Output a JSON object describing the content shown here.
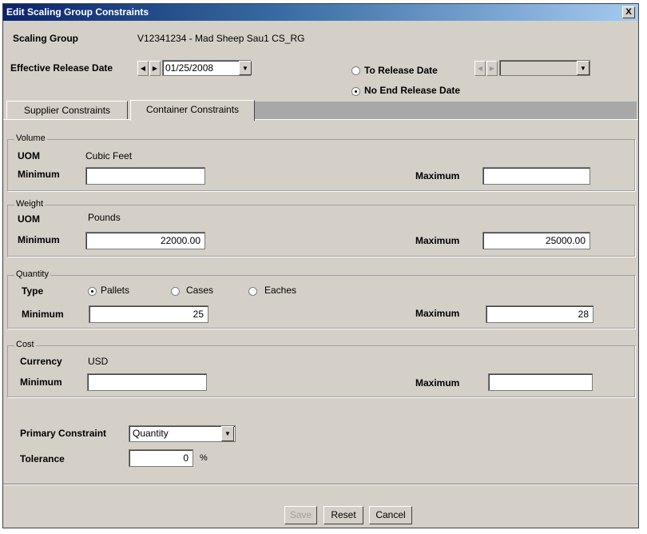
{
  "window": {
    "title": "Edit Scaling Group Constraints",
    "close_glyph": "X"
  },
  "header": {
    "scaling_group_label": "Scaling Group",
    "scaling_group_value": "V12341234  - Mad Sheep Sau1 CS_RG",
    "effective_release_label": "Effective Release Date",
    "effective_release_value": "01/25/2008",
    "to_release_label": "To Release Date",
    "to_release_value": "",
    "no_end_release_label": "No End Release Date",
    "selected_release_option": "No End Release Date"
  },
  "tabs": [
    {
      "label": "Supplier Constraints",
      "active": false
    },
    {
      "label": "Container Constraints",
      "active": true
    }
  ],
  "volume": {
    "legend": "Volume",
    "uom_label": "UOM",
    "uom_value": "Cubic Feet",
    "min_label": "Minimum",
    "min_value": "",
    "max_label": "Maximum",
    "max_value": ""
  },
  "weight": {
    "legend": "Weight",
    "uom_label": "UOM",
    "uom_value": "Pounds",
    "min_label": "Minimum",
    "min_value": "22000.00",
    "max_label": "Maximum",
    "max_value": "25000.00"
  },
  "quantity": {
    "legend": "Quantity",
    "type_label": "Type",
    "options": [
      "Pallets",
      "Cases",
      "Eaches"
    ],
    "selected": "Pallets",
    "min_label": "Minimum",
    "min_value": "25",
    "max_label": "Maximum",
    "max_value": "28"
  },
  "cost": {
    "legend": "Cost",
    "currency_label": "Currency",
    "currency_value": "USD",
    "min_label": "Minimum",
    "min_value": "",
    "max_label": "Maximum",
    "max_value": ""
  },
  "primary_constraint": {
    "label": "Primary Constraint",
    "value": "Quantity"
  },
  "tolerance": {
    "label": "Tolerance",
    "value": "0",
    "unit": "%"
  },
  "buttons": {
    "save": "Save",
    "reset": "Reset",
    "cancel": "Cancel",
    "save_enabled": false
  },
  "colors": {
    "titlebar_start": "#0a246a",
    "titlebar_end": "#a6caf0",
    "face": "#d4d0c8"
  }
}
